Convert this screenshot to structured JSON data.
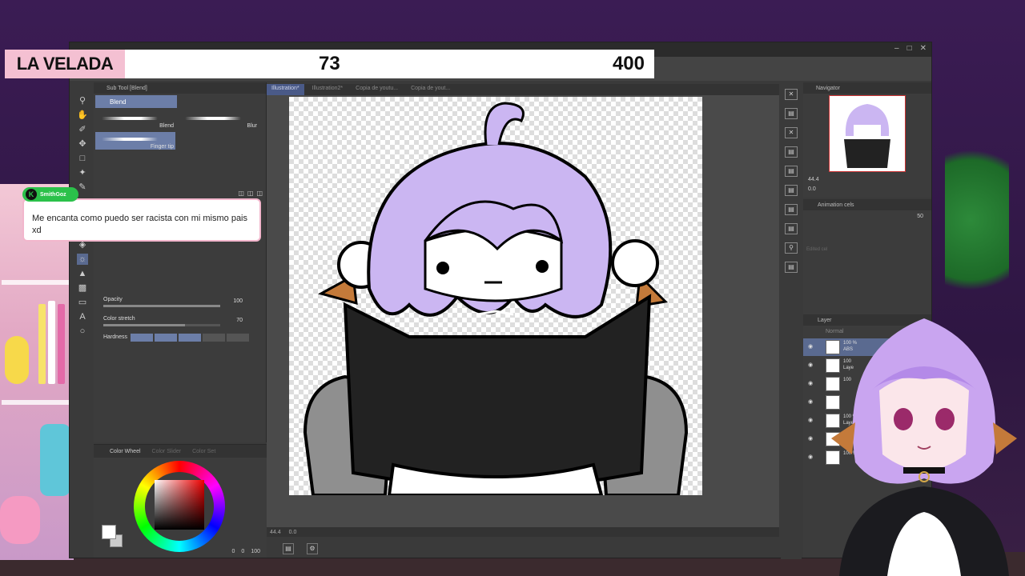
{
  "scoreboard": {
    "title": "LA VELADA",
    "left_score": "73",
    "right_score": "400"
  },
  "chat": {
    "username": "SmithGoz",
    "message": "Me encanta como puedo ser racista con mi mismo pais xd"
  },
  "subtool_panel": {
    "title": "Sub Tool [Blend]",
    "active_tab": "Blend",
    "brushes": [
      {
        "label": "Blend"
      },
      {
        "label": "Blur"
      },
      {
        "label": "Finger tip"
      }
    ],
    "properties": [
      {
        "label": "Opacity",
        "value": "100",
        "fill_pct": 100
      },
      {
        "label": "Color stretch",
        "value": "70",
        "fill_pct": 70
      }
    ],
    "hardness_label": "Hardness"
  },
  "color_panel": {
    "tabs": [
      "Color Wheel",
      "Color Slider",
      "Color Set"
    ],
    "footer_values": [
      "0",
      "0",
      "100"
    ],
    "main_color": "#ffffff",
    "sub_color": "#cccccc"
  },
  "canvas": {
    "tabs": [
      "Illustration*",
      "Illustration2*",
      "Copia de youtu...",
      "Copia de yout..."
    ],
    "zoom": "44.4",
    "angle": "0.0"
  },
  "navigator": {
    "title": "Navigator",
    "zoom": "44.4",
    "angle": "0.0"
  },
  "animation": {
    "title": "Animation cels",
    "value": "50",
    "ghost_text": "Edited cel"
  },
  "layer_panel": {
    "title": "Layer",
    "blend_mode": "Normal",
    "layers": [
      {
        "line1": "100 %",
        "line2": "ABS",
        "selected": true
      },
      {
        "line1": "100",
        "line2": "Laye",
        "selected": false
      },
      {
        "line1": "100",
        "line2": "",
        "selected": false
      },
      {
        "line1": "",
        "line2": "",
        "selected": false
      },
      {
        "line1": "100 % Norma",
        "line2": "Layer 10 Copy",
        "selected": false
      },
      {
        "line1": "100 % Normal",
        "line2": "Layer 10",
        "selected": false
      },
      {
        "line1": "100 %",
        "line2": "",
        "selected": false
      }
    ]
  },
  "colors": {
    "hair": "#cbb6f2",
    "hair_dark": "#9a7fd6",
    "sweater": "#222222",
    "chair": "#8f8f8f",
    "accent_pink": "#f4c0d2",
    "chat_green": "#2bc14a",
    "ui_selected": "#6c7ea8"
  }
}
